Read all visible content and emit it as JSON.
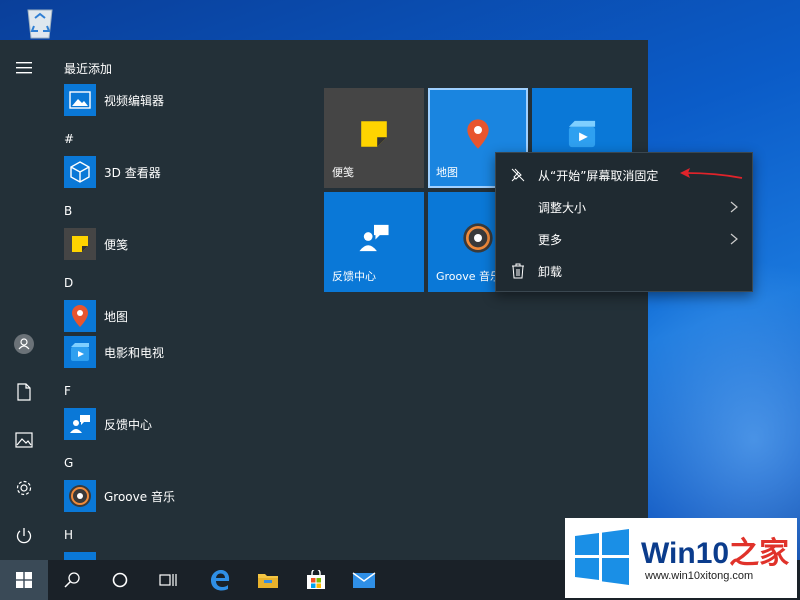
{
  "start_menu": {
    "recently_added_label": "最近添加",
    "apps": [
      {
        "letter": "",
        "label": "视频编辑器",
        "icon": "video-editor-icon"
      },
      {
        "letter": "#",
        "label": "3D 查看器",
        "icon": "cube-icon"
      },
      {
        "letter": "B",
        "label": "便笺",
        "icon": "sticky-note-icon"
      },
      {
        "letter": "D",
        "label": "地图",
        "icon": "map-pin-icon"
      },
      {
        "letter": "",
        "label": "电影和电视",
        "icon": "movies-icon"
      },
      {
        "letter": "F",
        "label": "反馈中心",
        "icon": "feedback-icon"
      },
      {
        "letter": "G",
        "label": "Groove 音乐",
        "icon": "groove-icon"
      },
      {
        "letter": "H",
        "label": "",
        "icon": ""
      }
    ],
    "letters": {
      "hash": "#",
      "b": "B",
      "d": "D",
      "f": "F",
      "g": "G",
      "h": "H"
    },
    "tiles": [
      {
        "label": "便笺",
        "color": "#454545"
      },
      {
        "label": "地图",
        "color": "#1a85e0"
      },
      {
        "label": "",
        "color": "#0a78d7"
      },
      {
        "label": "反馈中心",
        "color": "#0a78d7"
      },
      {
        "label": "Groove 音乐",
        "color": "#0a78d7"
      }
    ]
  },
  "context_menu": {
    "items": [
      {
        "label": "从“开始”屏幕取消固定",
        "icon": "unpin-icon"
      },
      {
        "label": "调整大小",
        "icon": ""
      },
      {
        "label": "更多",
        "icon": ""
      },
      {
        "label": "卸载",
        "icon": "trash-icon"
      }
    ]
  },
  "watermark": {
    "brand": "Win10",
    "brand_suffix": "之家",
    "url": "www.win10xitong.com"
  },
  "colors": {
    "menu_bg": "#233038",
    "accent": "#0a78d7",
    "taskbar": "#1a2128",
    "arrow": "#e0232a"
  }
}
